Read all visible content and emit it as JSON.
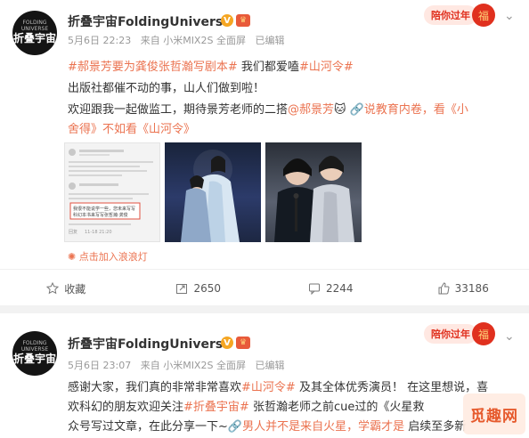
{
  "post1": {
    "avatar": {
      "small": "FOLDING UNIVERSE",
      "big": "折叠宇宙"
    },
    "name": "折叠宇宙FoldingUniverse",
    "meta": {
      "date": "5月6日 22:23",
      "source": "来自 小米MIX2S 全面屏",
      "edited": "已编辑"
    },
    "newyear": "陪你过年",
    "line1": {
      "tag1": "#郝景芳要为龚俊张哲瀚写剧本#",
      "mid": " 我们都爱嗑",
      "tag2": "#山河令#"
    },
    "line2": "出版社都催不动的事，山人们做到啦！",
    "line3": {
      "pre": "欢迎跟我一起做监工，期待景芳老师的二搭",
      "mention": "@郝景芳",
      "emoji": "🐱",
      "post": " ",
      "link": "🔗说教育内卷，看《小"
    },
    "line4": {
      "link": "舍得》不如看《山河令》"
    },
    "hint": "点击加入浪浪灯",
    "screenshot_text": {
      "quote1": "我很不能说学一些，您未来写写",
      "quote2": "科幻本书来写写张哲瀚·龚俊",
      "reply": "回复",
      "time": "11-18 21:20"
    },
    "actions": {
      "favorite": "收藏",
      "repost": "2650",
      "comment": "2244",
      "like": "33186"
    }
  },
  "post2": {
    "avatar": {
      "small": "FOLDING UNIVERSE",
      "big": "折叠宇宙"
    },
    "name": "折叠宇宙FoldingUniverse",
    "meta": {
      "date": "5月6日 23:07",
      "source": "来自 小米MIX2S 全面屏",
      "edited": "已编辑"
    },
    "newyear": "陪你过年",
    "line1": {
      "pre": "感谢大家，我们真的非常非常喜欢",
      "tag1": "#山河令#",
      "post": " 及其全体优秀演员！ 在这里想说，喜"
    },
    "line2": {
      "pre": "欢科幻的朋友欢迎关注",
      "tag1": "#折叠宇宙#",
      "post": "  张哲瀚老师之前cue过的《火星救"
    },
    "line3": {
      "pre": "众号写过文章，在此分享一下~",
      "link": "🔗男人并不是来自火星，学霸才是",
      "post": " 启续至多新"
    }
  },
  "watermark": "觅趣网"
}
